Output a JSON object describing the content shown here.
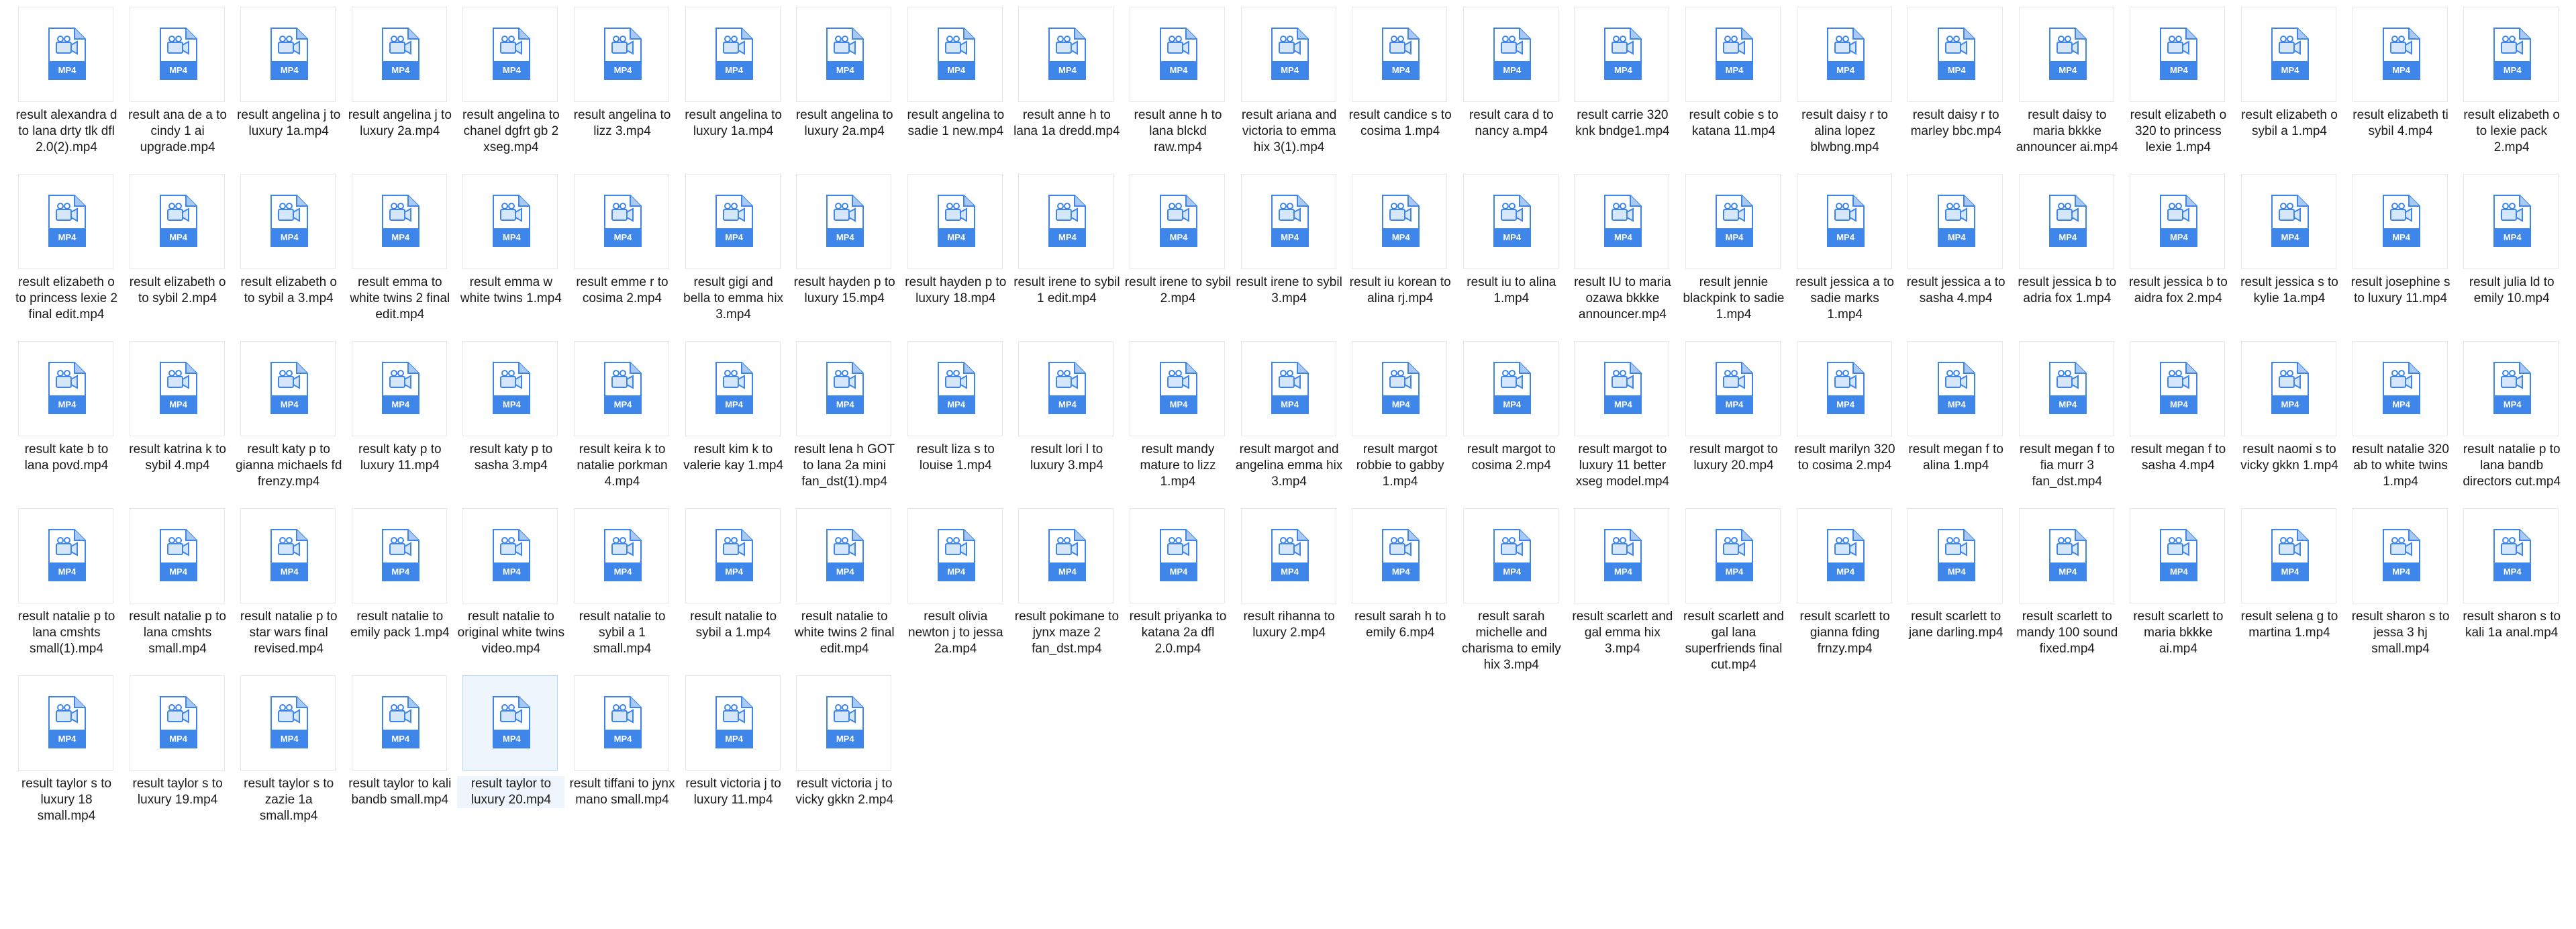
{
  "badge_label": "MP4",
  "colors": {
    "icon_blue": "#3f86ea",
    "icon_light": "#d6e6fb",
    "fold": "#a9c8f3"
  },
  "files": [
    {
      "name": "result alexandra d to lana drty tlk dfl 2.0(2).mp4"
    },
    {
      "name": "result ana de a to cindy 1 ai upgrade.mp4"
    },
    {
      "name": "result angelina j to luxury 1a.mp4"
    },
    {
      "name": "result angelina j to luxury 2a.mp4"
    },
    {
      "name": "result angelina to chanel dgfrt gb 2 xseg.mp4"
    },
    {
      "name": "result angelina to lizz 3.mp4"
    },
    {
      "name": "result angelina to luxury 1a.mp4"
    },
    {
      "name": "result angelina to luxury 2a.mp4"
    },
    {
      "name": "result angelina to sadie 1 new.mp4"
    },
    {
      "name": "result anne h to lana 1a dredd.mp4"
    },
    {
      "name": "result anne h to lana blckd raw.mp4"
    },
    {
      "name": "result ariana and victoria to emma hix 3(1).mp4"
    },
    {
      "name": "result candice s to cosima 1.mp4"
    },
    {
      "name": "result cara d to nancy a.mp4"
    },
    {
      "name": "result carrie 320 knk bndge1.mp4"
    },
    {
      "name": "result cobie s to katana 11.mp4"
    },
    {
      "name": "result daisy r to alina lopez blwbng.mp4"
    },
    {
      "name": "result daisy r to marley bbc.mp4"
    },
    {
      "name": "result daisy to maria bkkke announcer ai.mp4"
    },
    {
      "name": "result elizabeth o 320 to princess lexie 1.mp4"
    },
    {
      "name": "result elizabeth o sybil a 1.mp4"
    },
    {
      "name": "result elizabeth ti sybil 4.mp4"
    },
    {
      "name": "result elizabeth o to lexie pack 2.mp4"
    },
    {
      "name": "result elizabeth o to princess lexie 2 final edit.mp4"
    },
    {
      "name": "result elizabeth o to sybil 2.mp4"
    },
    {
      "name": "result elizabeth o to sybil a 3.mp4"
    },
    {
      "name": "result emma to white twins 2 final edit.mp4"
    },
    {
      "name": "result emma w white twins 1.mp4"
    },
    {
      "name": "result emme r to cosima 2.mp4"
    },
    {
      "name": "result gigi and bella to emma hix 3.mp4"
    },
    {
      "name": "result hayden p to luxury 15.mp4"
    },
    {
      "name": "result hayden p to luxury 18.mp4"
    },
    {
      "name": "result irene to sybil 1 edit.mp4"
    },
    {
      "name": "result irene to sybil 2.mp4"
    },
    {
      "name": "result irene to sybil 3.mp4"
    },
    {
      "name": "result iu korean to alina rj.mp4"
    },
    {
      "name": "result iu to alina 1.mp4"
    },
    {
      "name": "result IU to maria ozawa bkkke announcer.mp4"
    },
    {
      "name": "result jennie blackpink to sadie 1.mp4"
    },
    {
      "name": "result jessica a to sadie marks 1.mp4"
    },
    {
      "name": "result jessica a to sasha 4.mp4"
    },
    {
      "name": "result jessica b to adria fox 1.mp4"
    },
    {
      "name": "result jessica b to aidra fox 2.mp4"
    },
    {
      "name": "result jessica s to kylie 1a.mp4"
    },
    {
      "name": "result josephine s to luxury 11.mp4"
    },
    {
      "name": "result julia ld to emily 10.mp4"
    },
    {
      "name": "result kate b to lana povd.mp4"
    },
    {
      "name": "result katrina k to sybil 4.mp4"
    },
    {
      "name": "result katy p to gianna michaels fd frenzy.mp4"
    },
    {
      "name": "result katy p to luxury 11.mp4"
    },
    {
      "name": "result katy p to sasha 3.mp4"
    },
    {
      "name": "result keira k to natalie porkman 4.mp4"
    },
    {
      "name": "result kim k to valerie kay 1.mp4"
    },
    {
      "name": "result lena h GOT to lana 2a mini fan_dst(1).mp4"
    },
    {
      "name": "result liza s to louise 1.mp4"
    },
    {
      "name": "result lori l to luxury 3.mp4"
    },
    {
      "name": "result mandy mature to lizz 1.mp4"
    },
    {
      "name": "result margot and angelina emma hix 3.mp4"
    },
    {
      "name": "result margot robbie to gabby 1.mp4"
    },
    {
      "name": "result margot to cosima 2.mp4"
    },
    {
      "name": "result margot to luxury 11 better xseg model.mp4"
    },
    {
      "name": "result margot to luxury 20.mp4"
    },
    {
      "name": "result marilyn 320 to cosima 2.mp4"
    },
    {
      "name": "result megan f to alina 1.mp4"
    },
    {
      "name": "result megan f to fia murr 3 fan_dst.mp4"
    },
    {
      "name": "result megan f to sasha 4.mp4"
    },
    {
      "name": "result naomi s to vicky gkkn 1.mp4"
    },
    {
      "name": "result natalie 320 ab to white twins 1.mp4"
    },
    {
      "name": "result natalie p to lana bandb directors cut.mp4"
    },
    {
      "name": "result natalie p to lana cmshts small(1).mp4"
    },
    {
      "name": "result natalie p to lana cmshts small.mp4"
    },
    {
      "name": "result natalie p to star wars final revised.mp4"
    },
    {
      "name": "result natalie to emily pack 1.mp4"
    },
    {
      "name": "result natalie to original white twins video.mp4"
    },
    {
      "name": "result natalie to sybil a 1 small.mp4"
    },
    {
      "name": "result natalie to sybil a 1.mp4"
    },
    {
      "name": "result natalie to white twins 2 final edit.mp4"
    },
    {
      "name": "result olivia newton j to jessa 2a.mp4"
    },
    {
      "name": "result pokimane to jynx maze 2 fan_dst.mp4"
    },
    {
      "name": "result priyanka to katana 2a dfl 2.0.mp4"
    },
    {
      "name": "result rihanna to luxury 2.mp4"
    },
    {
      "name": "result sarah h to emily 6.mp4"
    },
    {
      "name": "result sarah michelle and charisma to emily hix 3.mp4"
    },
    {
      "name": "result scarlett and gal emma hix 3.mp4"
    },
    {
      "name": "result scarlett and gal lana superfriends final cut.mp4"
    },
    {
      "name": "result scarlett to gianna fding frnzy.mp4"
    },
    {
      "name": "result scarlett to jane darling.mp4"
    },
    {
      "name": "result scarlett to mandy 100 sound fixed.mp4"
    },
    {
      "name": "result scarlett to maria bkkke ai.mp4"
    },
    {
      "name": "result selena g to martina 1.mp4"
    },
    {
      "name": "result sharon s to jessa 3 hj small.mp4"
    },
    {
      "name": "result sharon s to kali 1a anal.mp4"
    },
    {
      "name": "result taylor s to luxury 18 small.mp4"
    },
    {
      "name": "result taylor s to luxury 19.mp4"
    },
    {
      "name": "result taylor s to zazie 1a small.mp4"
    },
    {
      "name": "result taylor to kali bandb small.mp4"
    },
    {
      "name": "result taylor to luxury 20.mp4",
      "selected": true
    },
    {
      "name": "result tiffani to jynx mano small.mp4"
    },
    {
      "name": "result victoria j to luxury 11.mp4"
    },
    {
      "name": "result victoria j to vicky gkkn 2.mp4"
    }
  ]
}
